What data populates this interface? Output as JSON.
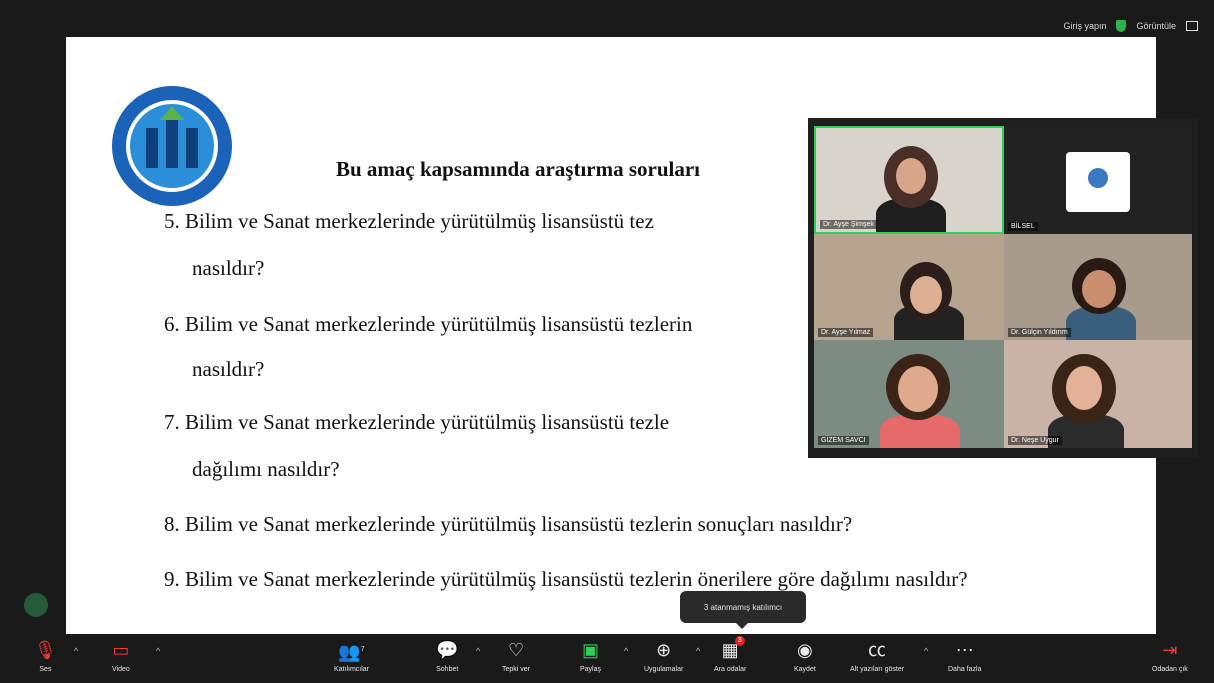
{
  "topbar": {
    "login_label": "Giriş yapın",
    "view_label": "Görüntüle"
  },
  "slide": {
    "title": "Bu amaç kapsamında araştırma soruları",
    "questions": [
      {
        "line1": "5. Bilim ve Sanat merkezlerinde yürütülmüş lisansüstü tez",
        "line2": "nasıldır?"
      },
      {
        "line1": "6. Bilim ve Sanat merkezlerinde yürütülmüş lisansüstü tezlerin",
        "line2": "nasıldır?"
      },
      {
        "line1": "7. Bilim ve Sanat merkezlerinde yürütülmüş lisansüstü tezle",
        "line2": "dağılımı nasıldır?"
      },
      {
        "line1": "8. Bilim ve Sanat merkezlerinde yürütülmüş lisansüstü tezlerin sonuçları nasıldır?"
      },
      {
        "line1": "9. Bilim ve Sanat merkezlerinde yürütülmüş lisansüstü tezlerin önerilere göre dağılımı nasıldır?"
      }
    ]
  },
  "participants": [
    {
      "name": "Dr. Ayşe Şimşek"
    },
    {
      "name": "BİLSEL"
    },
    {
      "name": "Dr. Ayşe Yılmaz"
    },
    {
      "name": "Dr. Gülçin Yıldırım"
    },
    {
      "name": "GİZEM SAVCI"
    },
    {
      "name": "Dr. Neşe Uygur"
    }
  ],
  "tooltip": "3 atanmamış katılımcı",
  "toolbar": {
    "audio": "Ses",
    "video": "Video",
    "participants": "Katılımcılar",
    "participants_count": "7",
    "chat": "Sohbet",
    "reactions": "Tepki ver",
    "share": "Paylaş",
    "apps": "Uygulamalar",
    "breakout": "Ara odalar",
    "breakout_badge": "3",
    "record": "Kaydet",
    "captions": "Alt yazıları göster",
    "more": "Daha fazla",
    "leave": "Odadan çık"
  }
}
